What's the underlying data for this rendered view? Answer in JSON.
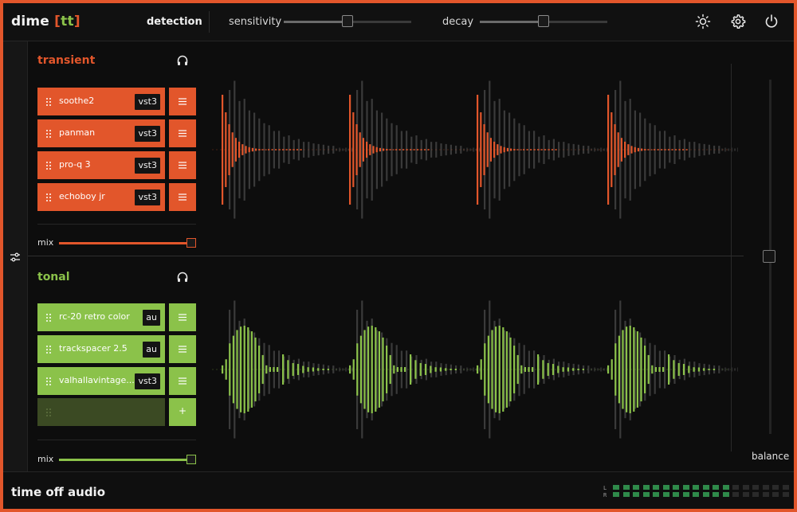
{
  "app": {
    "logo_main": "dime",
    "logo_open": "[",
    "logo_tag": "tt",
    "logo_close": "]"
  },
  "topbar": {
    "detection_label": "detection",
    "sensitivity_label": "sensitivity",
    "sensitivity_value": 0.5,
    "decay_label": "decay",
    "decay_value": 0.5,
    "icons": [
      "sun-icon",
      "gear-icon",
      "power-icon"
    ]
  },
  "colors": {
    "transient": "#e2562b",
    "tonal": "#8bc24a",
    "background": "#0d0d0d"
  },
  "transient": {
    "title": "transient",
    "plugins": [
      {
        "name": "soothe2",
        "format": "vst3"
      },
      {
        "name": "panman",
        "format": "vst3"
      },
      {
        "name": "pro-q 3",
        "format": "vst3"
      },
      {
        "name": "echoboy jr",
        "format": "vst3"
      }
    ],
    "mix_label": "mix",
    "mix_value": 1.0
  },
  "tonal": {
    "title": "tonal",
    "plugins": [
      {
        "name": "rc-20 retro color",
        "format": "au"
      },
      {
        "name": "trackspacer 2.5",
        "format": "au"
      },
      {
        "name": "valhallavintage...",
        "format": "vst3"
      }
    ],
    "add_label": "+",
    "mix_label": "mix",
    "mix_value": 1.0
  },
  "balance": {
    "label": "balance",
    "value": 0.5
  },
  "footer": {
    "brand": "time off audio",
    "meter_l": "L",
    "meter_r": "R",
    "meter_level": 0.67
  }
}
